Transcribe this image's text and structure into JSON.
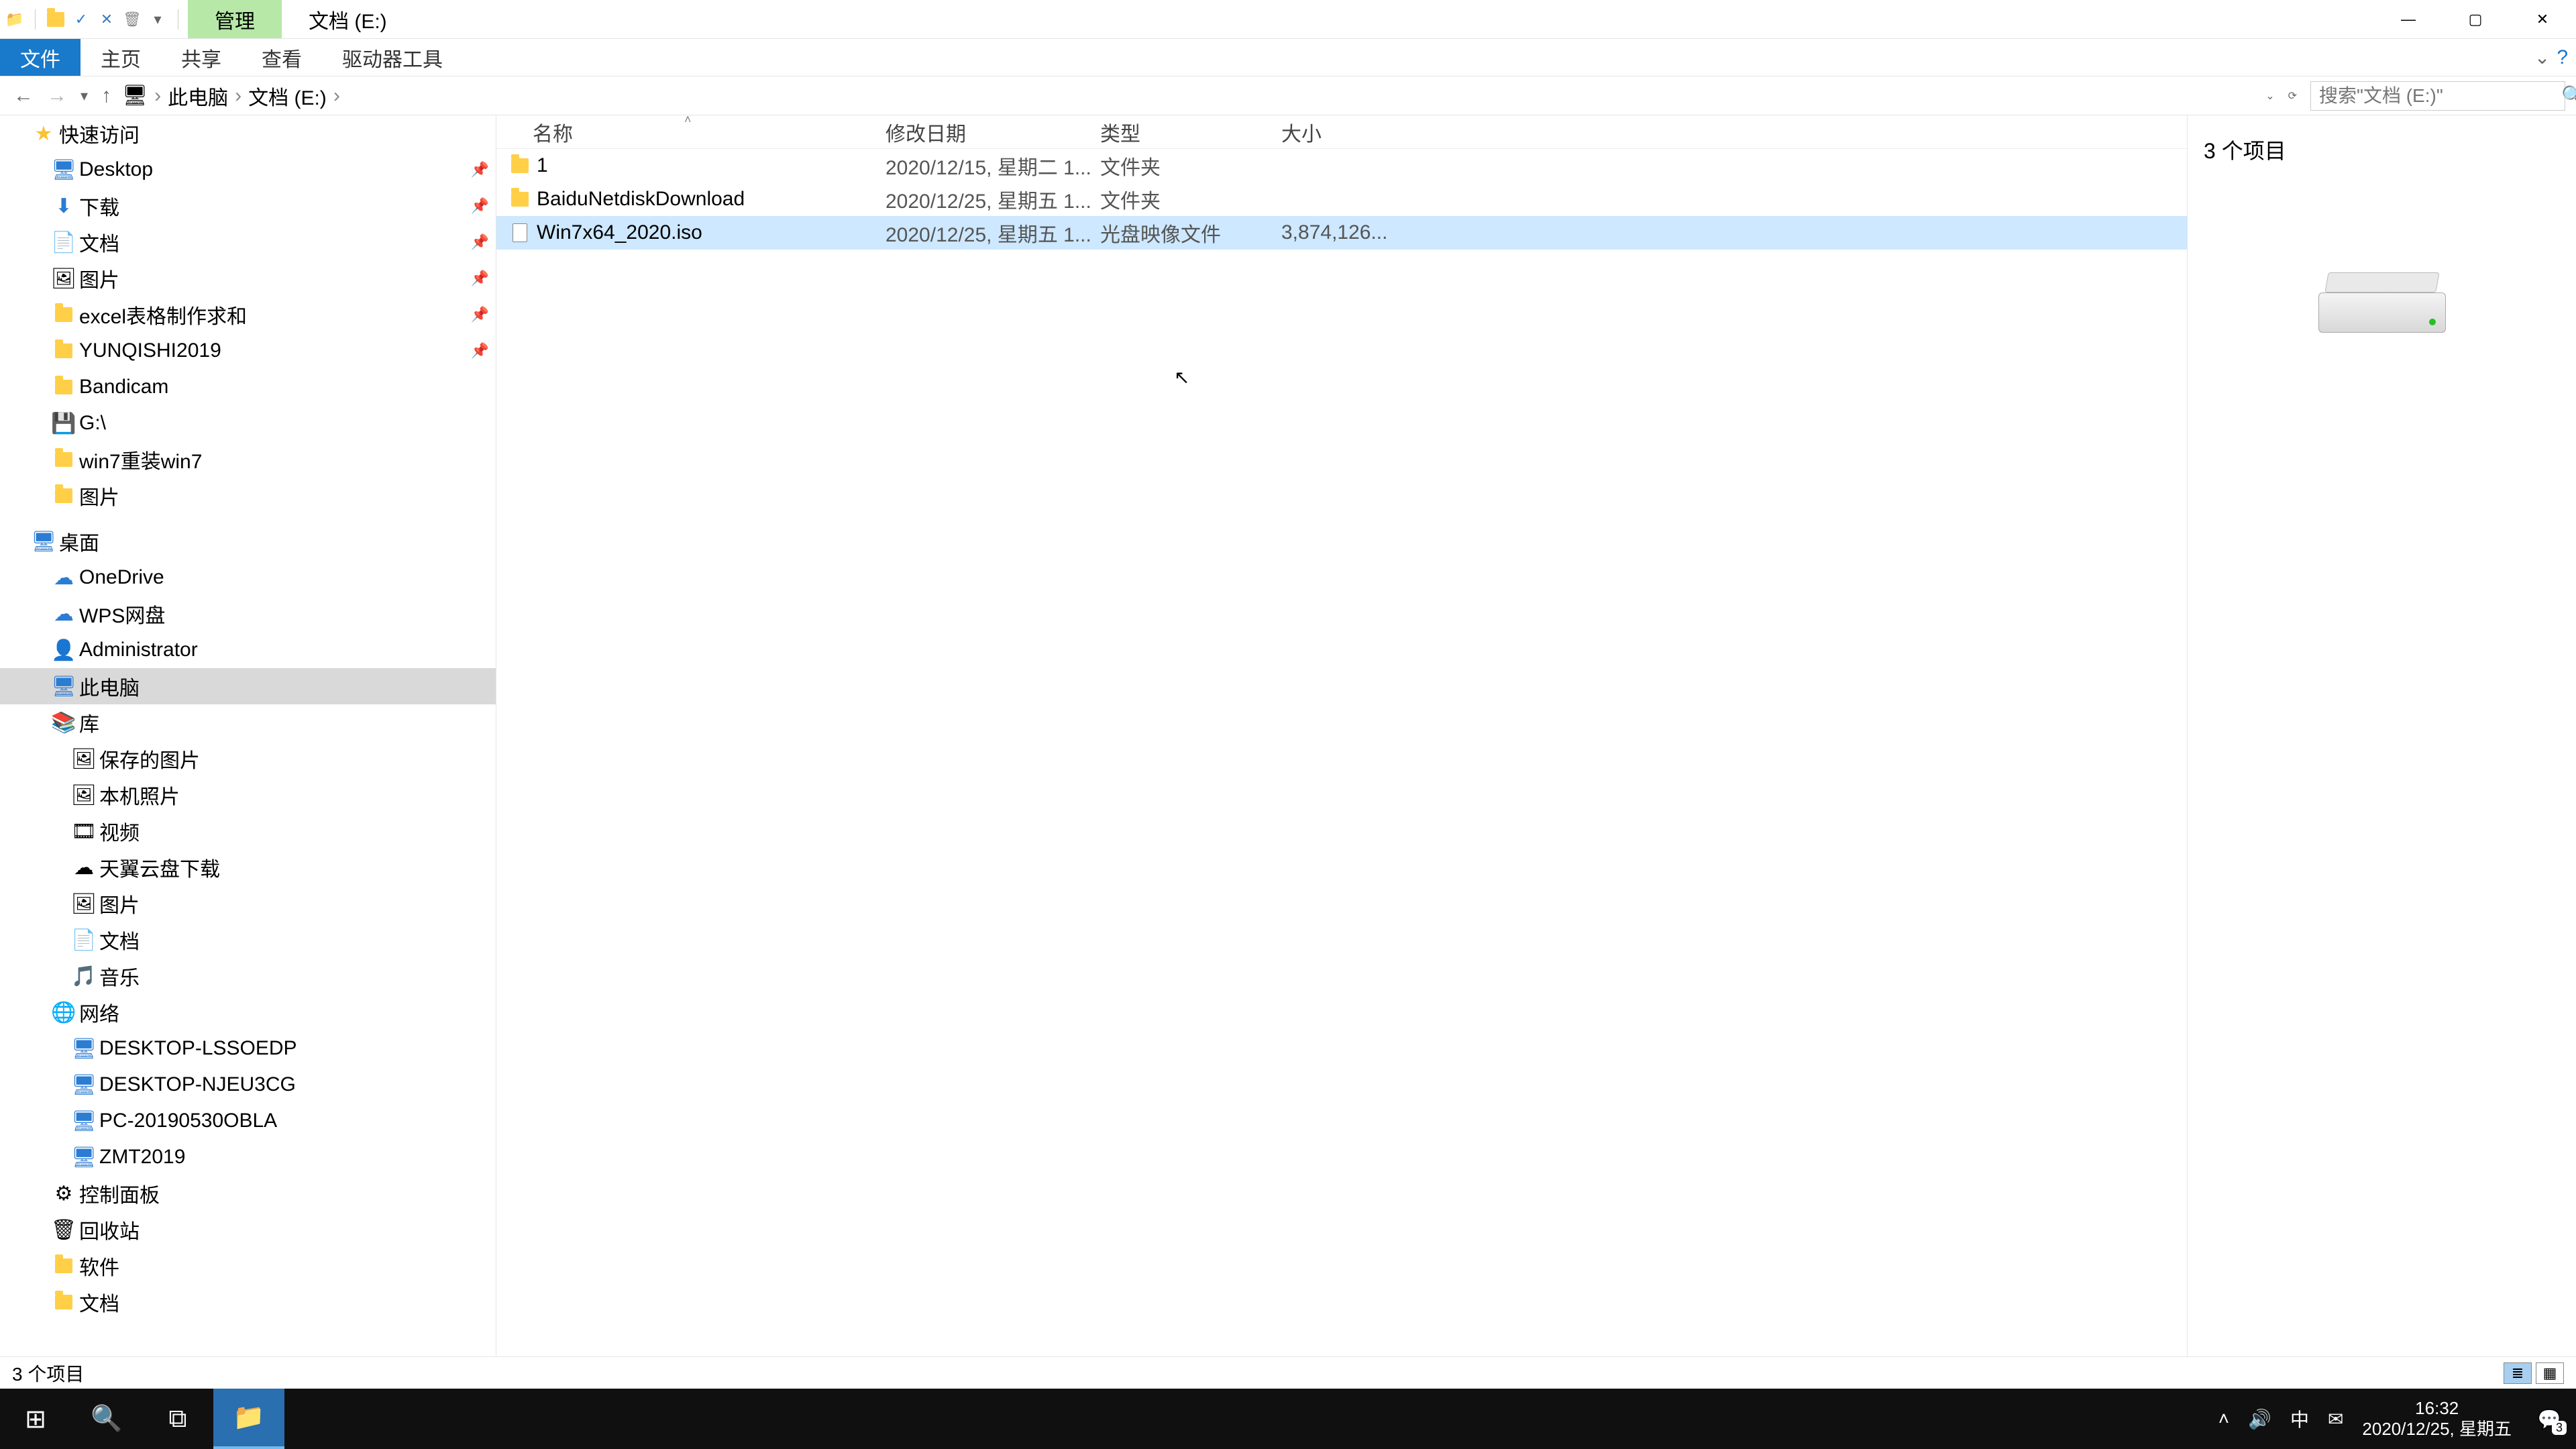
{
  "titlebar": {
    "manage_tab": "管理",
    "title": "文档 (E:)"
  },
  "ribbon": {
    "file": "文件",
    "home": "主页",
    "share": "共享",
    "view": "查看",
    "drive_tools": "驱动器工具"
  },
  "breadcrumb": {
    "pc": "此电脑",
    "drive": "文档 (E:)"
  },
  "search": {
    "placeholder": "搜索\"文档 (E:)\""
  },
  "sidebar": {
    "quick_access": "快速访问",
    "pinned": [
      {
        "label": "Desktop"
      },
      {
        "label": "下载"
      },
      {
        "label": "文档"
      },
      {
        "label": "图片"
      },
      {
        "label": "excel表格制作求和"
      },
      {
        "label": "YUNQISHI2019"
      },
      {
        "label": "Bandicam"
      },
      {
        "label": "G:\\"
      },
      {
        "label": "win7重装win7"
      },
      {
        "label": "图片"
      }
    ],
    "desktop": "桌面",
    "desktop_children": [
      {
        "label": "OneDrive"
      },
      {
        "label": "WPS网盘"
      },
      {
        "label": "Administrator"
      },
      {
        "label": "此电脑"
      },
      {
        "label": "库"
      }
    ],
    "libraries": [
      {
        "label": "保存的图片"
      },
      {
        "label": "本机照片"
      },
      {
        "label": "视频"
      },
      {
        "label": "天翼云盘下载"
      },
      {
        "label": "图片"
      },
      {
        "label": "文档"
      },
      {
        "label": "音乐"
      }
    ],
    "network": "网络",
    "network_items": [
      {
        "label": "DESKTOP-LSSOEDP"
      },
      {
        "label": "DESKTOP-NJEU3CG"
      },
      {
        "label": "PC-20190530OBLA"
      },
      {
        "label": "ZMT2019"
      }
    ],
    "control_panel": "控制面板",
    "recycle_bin": "回收站",
    "software": "软件",
    "docs": "文档"
  },
  "columns": {
    "name": "名称",
    "date": "修改日期",
    "type": "类型",
    "size": "大小"
  },
  "files": [
    {
      "name": "1",
      "date": "2020/12/15, 星期二 1...",
      "type": "文件夹",
      "size": "",
      "icon": "folder",
      "selected": false
    },
    {
      "name": "BaiduNetdiskDownload",
      "date": "2020/12/25, 星期五 1...",
      "type": "文件夹",
      "size": "",
      "icon": "folder",
      "selected": false
    },
    {
      "name": "Win7x64_2020.iso",
      "date": "2020/12/25, 星期五 1...",
      "type": "光盘映像文件",
      "size": "3,874,126...",
      "icon": "file",
      "selected": true
    }
  ],
  "preview": {
    "item_count": "3 个项目"
  },
  "status": {
    "text": "3 个项目"
  },
  "taskbar": {
    "time": "16:32",
    "date": "2020/12/25, 星期五",
    "notif_count": "3",
    "ime": "中"
  }
}
